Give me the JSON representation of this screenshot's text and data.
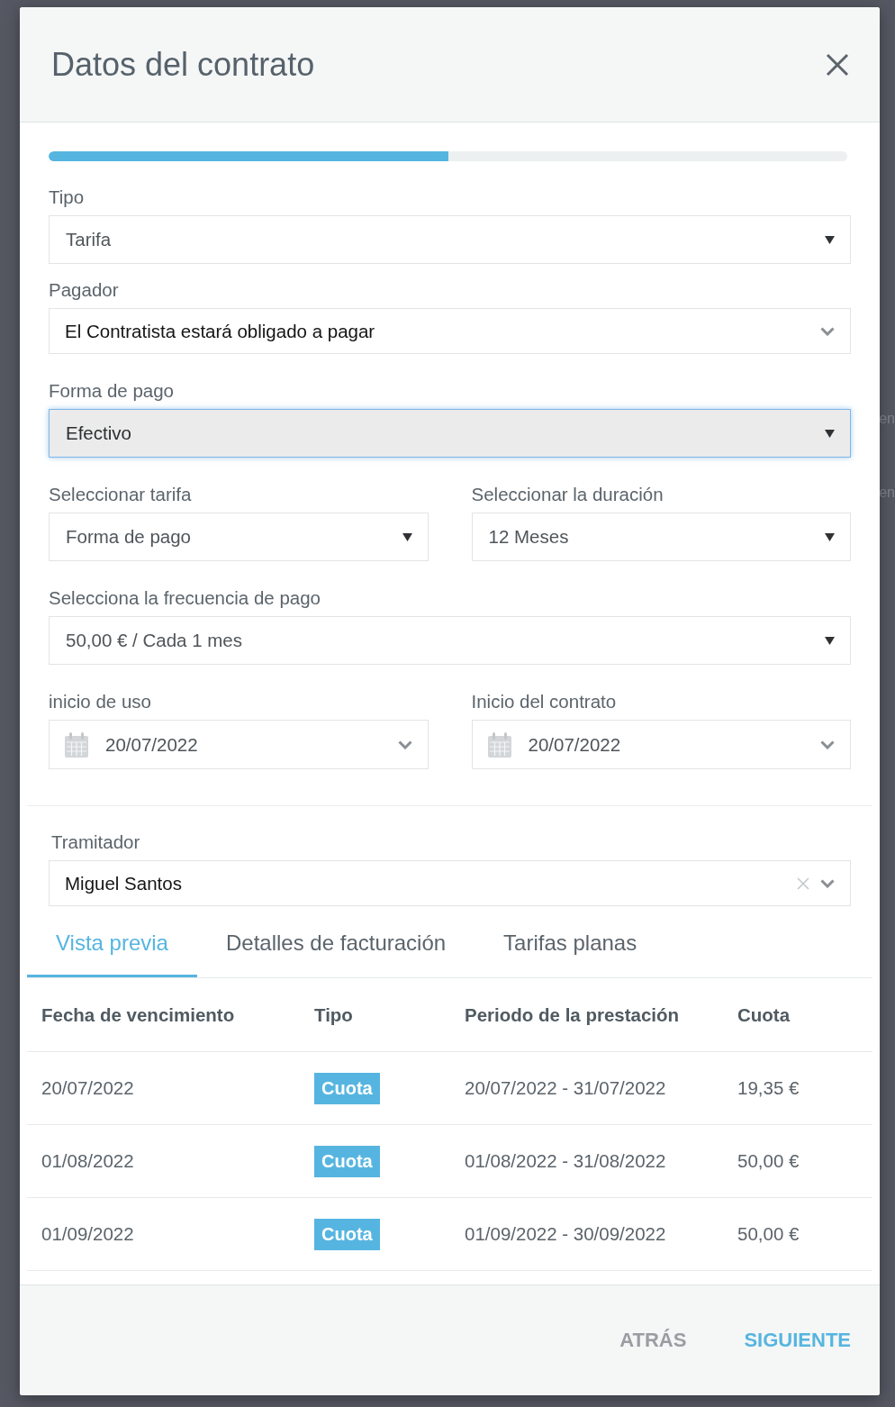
{
  "backdrop": {
    "fragments": [
      "en",
      "en"
    ]
  },
  "dialog": {
    "title": "Datos del contrato"
  },
  "progress": {
    "level": 0.5
  },
  "form": [
    {
      "fields": [
        {
          "kind": "select",
          "label": "Tipo",
          "value": "Tarifa",
          "focused": false
        }
      ]
    },
    {
      "fields": [
        {
          "kind": "dropdown",
          "label": "Pagador",
          "value": "El Contratista estará obligado a pagar",
          "focused": false
        }
      ]
    },
    {
      "fields": [
        {
          "kind": "select",
          "label": "Forma de pago",
          "value": "Efectivo",
          "focused": true
        }
      ]
    },
    {
      "fields": [
        {
          "kind": "select",
          "label": "Seleccionar tarifa",
          "value": "Forma de pago",
          "focused": false
        },
        {
          "kind": "select",
          "label": "Seleccionar la duración",
          "value": "12 Meses",
          "focused": false
        }
      ]
    },
    {
      "fields": [
        {
          "kind": "select",
          "label": "Selecciona la frecuencia de pago",
          "value": "50,00 € / Cada 1 mes",
          "focused": false
        }
      ]
    },
    {
      "fields": [
        {
          "kind": "date",
          "label": "inicio de uso",
          "value": "20/07/2022",
          "focused": false
        },
        {
          "kind": "date",
          "label": "Inicio del contrato",
          "value": "20/07/2022",
          "focused": false
        }
      ]
    }
  ],
  "assignee": {
    "label": "Tramitador",
    "value": "Miguel Santos",
    "clearable": true
  },
  "tabs": [
    {
      "label": "Vista previa",
      "selected": true
    },
    {
      "label": "Detalles de facturación",
      "selected": false
    },
    {
      "label": "Tarifas planas",
      "selected": false
    }
  ],
  "table": {
    "columns": [
      "Fecha de vencimiento",
      "Tipo",
      "Periodo de la prestación",
      "Cuota"
    ],
    "rows": [
      {
        "due_date": "20/07/2022",
        "type": "Cuota",
        "period": "20/07/2022 - 31/07/2022",
        "amount": "19,35 €"
      },
      {
        "due_date": "01/08/2022",
        "type": "Cuota",
        "period": "01/08/2022 - 31/08/2022",
        "amount": "50,00 €"
      },
      {
        "due_date": "01/09/2022",
        "type": "Cuota",
        "period": "01/09/2022 - 30/09/2022",
        "amount": "50,00 €"
      }
    ]
  },
  "footer": {
    "buttons": [
      {
        "kind": "back",
        "label": "ATRÁS"
      },
      {
        "kind": "next",
        "label": "SIGUIENTE"
      }
    ]
  }
}
